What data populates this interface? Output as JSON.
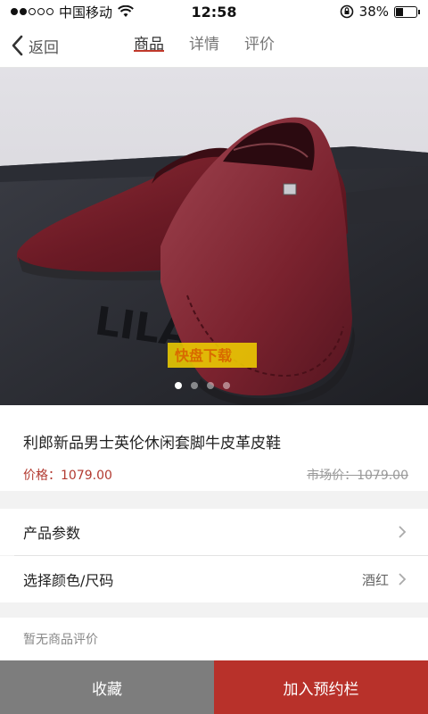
{
  "status_bar": {
    "carrier": "中国移动",
    "time": "12:58",
    "battery": "38%",
    "battery_level": 0.38
  },
  "nav": {
    "back_label": "返回",
    "tabs": [
      {
        "label": "商品"
      },
      {
        "label": "详情"
      },
      {
        "label": "评价"
      }
    ],
    "active_tab": "商品"
  },
  "gallery": {
    "image": "maroon leather loafer shoes on black box",
    "slide_count": 4,
    "active_slide": 1,
    "watermark": "快盘下载"
  },
  "product": {
    "title": "利郎新品男士英伦休闲套脚牛皮革皮鞋",
    "price_label": "价格：1079.00",
    "market_price_label": "市场价：1079.00"
  },
  "options": {
    "params_label": "产品参数",
    "color_size_label": "选择颜色/尺码",
    "color_size_value": "酒红"
  },
  "reviews": {
    "empty_text": "暂无商品评价"
  },
  "actions": {
    "favorite_label": "收藏",
    "add_label": "加入预约栏"
  },
  "colors": {
    "accent": "#b8312a",
    "favorite_bg": "#7d7d7d",
    "price": "#b23a30"
  }
}
